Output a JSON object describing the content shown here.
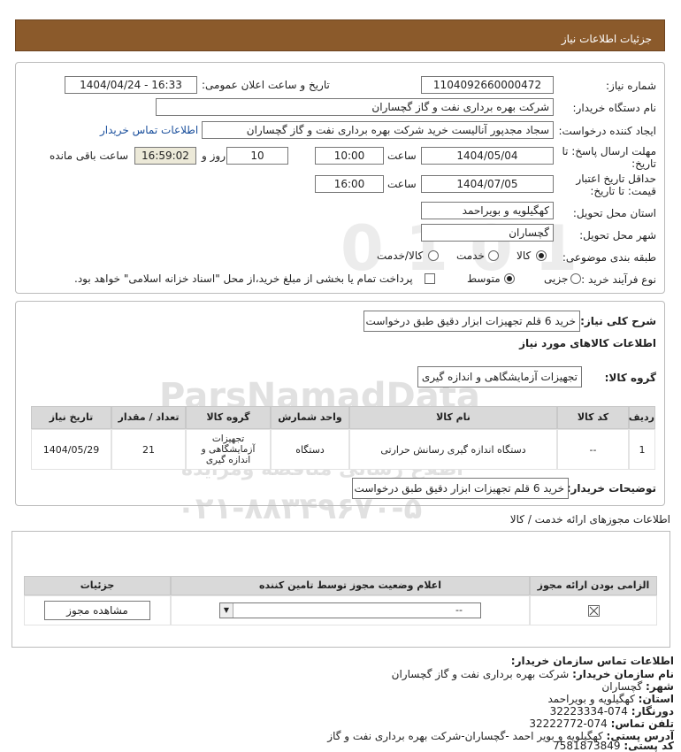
{
  "header": {
    "title": "جزئیات اطلاعات نیاز"
  },
  "form": {
    "need_no_label": "شماره نیاز:",
    "need_no": "1104092660000472",
    "announce_label": "تاریخ و ساعت اعلان عمومی:",
    "announce_value": "1404/04/24 - 16:33",
    "buyer_label": "نام دستگاه خریدار:",
    "buyer_value": "شرکت بهره برداری نفت و گاز گچساران",
    "creator_label": "ایجاد کننده درخواست:",
    "creator_value": "سجاد مجدپور آنالیست خرید شرکت بهره برداری نفت و گاز گچساران",
    "contact_link": "اطلاعات تماس خریدار",
    "deadline_label_1": "مهلت ارسال پاسخ: تا",
    "deadline_label_2": "تاریخ:",
    "deadline_date": "1404/05/04",
    "time_label": "ساعت",
    "deadline_time": "10:00",
    "days_value": "10",
    "days_label": "روز و",
    "remaining_time": "16:59:02",
    "remaining_label": "ساعت باقی مانده",
    "validity_label_1": "حداقل تاریخ اعتبار",
    "validity_label_2": "قیمت: تا تاریخ:",
    "validity_date": "1404/07/05",
    "validity_time": "16:00",
    "province_label": "استان محل تحویل:",
    "province_value": "کهگیلویه و بویراحمد",
    "city_label": "شهر محل تحویل:",
    "city_value": "گچساران",
    "category_label": "طبقه بندی موضوعی:",
    "category_options": [
      "کالا",
      "خدمت",
      "کالا/خدمت"
    ],
    "process_label": "نوع فرآیند خرید :",
    "process_options": [
      "جزیی",
      "متوسط"
    ],
    "payment_note": "پرداخت تمام یا بخشی از مبلغ خرید،از محل \"اسناد خزانه اسلامی\" خواهد بود."
  },
  "summary": {
    "desc_label": "شرح کلی نیاز:",
    "desc_value": "خرید 6 قلم تجهیزات ابزار دقیق طبق درخواست",
    "goods_info_title": "اطلاعات کالاهای مورد نیاز",
    "group_label": "گروه کالا:",
    "group_value": "تجهیزات آزمایشگاهی و اندازه گیری",
    "table_headers": [
      "ردیف",
      "کد کالا",
      "نام کالا",
      "واحد شمارش",
      "گروه کالا",
      "تعداد / مقدار",
      "تاریخ نیاز"
    ],
    "rows": [
      {
        "row": "1",
        "code": "--",
        "name": "دستگاه اندازه گیری رسانش حرارتی",
        "unit": "دستگاه",
        "group": "تجهیزات آزمایشگاهی و اندازه گیری",
        "qty": "21",
        "date": "1404/05/29"
      }
    ],
    "buyer_desc_label": "توضیحات خریدار:",
    "buyer_desc_value": "خرید 6 قلم تجهیزات ابزار دقیق طبق درخواست"
  },
  "permits": {
    "title": "اطلاعات مجوزهای ارائه خدمت / کالا",
    "headers": [
      "الزامی بودن ارائه مجوز",
      "اعلام وضعیت مجوز توسط تامین کننده",
      "جزئیات"
    ],
    "select_value": "--",
    "view_button": "مشاهده مجوز"
  },
  "contact": {
    "title": "اطلاعات تماس سازمان خریدار:",
    "org_label": "نام سازمان خریدار:",
    "org_value": "شرکت بهره برداری نفت و گاز گچساران",
    "city_label": "شهر:",
    "city_value": "گچساران",
    "province_label": "استان:",
    "province_value": "کهگیلویه و بویراحمد",
    "fax_label": "دورنگار:",
    "fax_value": "074-32223334",
    "phone_label": "تلفن تماس:",
    "phone_value": "074-32222772",
    "address_label": "آدرس پستی:",
    "address_value": "کهگیلویه و بویر احمد -گچساران-شرکت بهره برداری نفت و گاز",
    "postal_label": "کد پستی:",
    "postal_value": "7581873849"
  },
  "watermark": {
    "line1": "ParsNamadData",
    "line2": "مرکز فراوری اطلاعات پارس نماد داده",
    "line3": "اطلاع رسانی مناقصه ومزایده",
    "line4": "۰۲۱-۸۸۳۴۹۶۷۰-۵"
  },
  "colors": {
    "header_bg": "#8b5a2b",
    "table_header_bg": "#d9d9d9",
    "link": "#1a4f9c"
  }
}
